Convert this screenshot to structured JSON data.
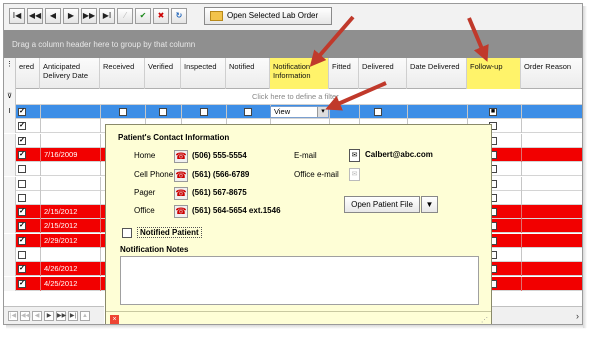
{
  "toolbar": {
    "buttons": [
      {
        "name": "first-record-button",
        "glyph": "I◀"
      },
      {
        "name": "previous-page-button",
        "glyph": "◀◀"
      },
      {
        "name": "previous-record-button",
        "glyph": "◀"
      },
      {
        "name": "next-record-button",
        "glyph": "▶"
      },
      {
        "name": "next-page-button",
        "glyph": "▶▶"
      },
      {
        "name": "last-record-button",
        "glyph": "▶I"
      },
      {
        "name": "edit-button",
        "glyph": "⁄"
      },
      {
        "name": "confirm-button",
        "glyph": "✔"
      },
      {
        "name": "cancel-button",
        "glyph": "✖"
      },
      {
        "name": "refresh-button",
        "glyph": "↻"
      }
    ],
    "open_lab_order": "Open Selected Lab Order"
  },
  "group_panel_text": "Drag a column header here to group by that column",
  "columns": [
    {
      "label": "ered",
      "highlight": false
    },
    {
      "label": "Anticipated Delivery Date",
      "highlight": false
    },
    {
      "label": "Received",
      "highlight": false
    },
    {
      "label": "Verified",
      "highlight": false
    },
    {
      "label": "Inspected",
      "highlight": false
    },
    {
      "label": "Notified",
      "highlight": false
    },
    {
      "label": "Notification Information",
      "highlight": true
    },
    {
      "label": "Fitted",
      "highlight": false
    },
    {
      "label": "Delivered",
      "highlight": false
    },
    {
      "label": "Date Delivered",
      "highlight": false
    },
    {
      "label": "Follow-up",
      "highlight": true
    },
    {
      "label": "Order Reason",
      "highlight": false
    }
  ],
  "filter_text": "Click here to define a filter",
  "rows": [
    {
      "checked": true,
      "date": "",
      "red": false,
      "selected": true
    },
    {
      "checked": true,
      "date": "",
      "red": false,
      "selected": false
    },
    {
      "checked": true,
      "date": "",
      "red": false,
      "selected": false
    },
    {
      "checked": true,
      "date": "7/16/2009",
      "red": true,
      "selected": false
    },
    {
      "checked": false,
      "date": "",
      "red": false,
      "selected": false
    },
    {
      "checked": false,
      "date": "",
      "red": false,
      "selected": false
    },
    {
      "checked": false,
      "date": "",
      "red": false,
      "selected": false
    },
    {
      "checked": true,
      "date": "2/15/2012",
      "red": true,
      "selected": false
    },
    {
      "checked": true,
      "date": "2/15/2012",
      "red": true,
      "selected": false
    },
    {
      "checked": true,
      "date": "2/29/2012",
      "red": true,
      "selected": false
    },
    {
      "checked": false,
      "date": "",
      "red": false,
      "selected": false
    },
    {
      "checked": true,
      "date": "4/26/2012",
      "red": true,
      "selected": false
    },
    {
      "checked": true,
      "date": "4/25/2012",
      "red": true,
      "selected": false
    }
  ],
  "view_combo": "View",
  "popup": {
    "title": "Patient's Contact Information",
    "phones": [
      {
        "label": "Home",
        "value": "(506) 555-5554"
      },
      {
        "label": "Cell Phone",
        "value": "(561) (566-6789"
      },
      {
        "label": "Pager",
        "value": "(561) 567-8675"
      },
      {
        "label": "Office",
        "value": "(561) 564-5654 ext.1546"
      }
    ],
    "email_label": "E-mail",
    "email_value": "Calbert@abc.com",
    "office_email_label": "Office e-mail",
    "open_patient_file": "Open Patient File",
    "notified_patient": "Notified Patient",
    "notification_notes": "Notification Notes"
  },
  "colors": {
    "highlight": "#fff36a",
    "red_row": "#f20000",
    "selected_row": "#3d8ee6",
    "arrow": "#c0392b"
  }
}
